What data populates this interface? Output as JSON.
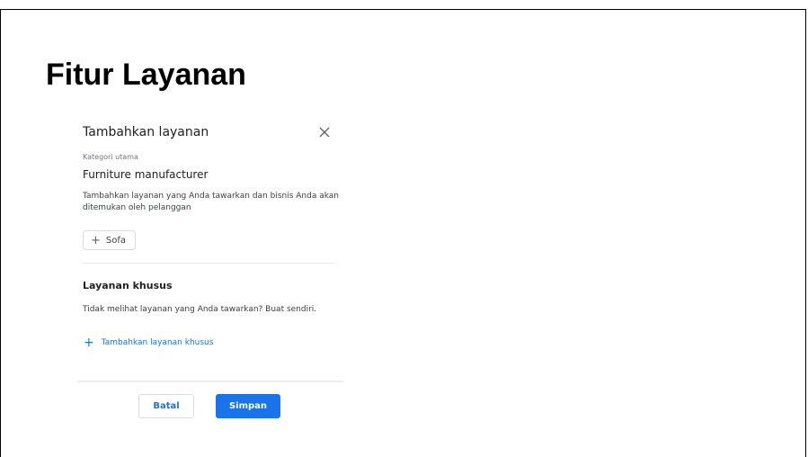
{
  "slide": {
    "title": "Fitur Layanan"
  },
  "dialog": {
    "title": "Tambahkan layanan",
    "close_icon": "close-icon",
    "category_label": "Kategori utama",
    "category_value": "Furniture manufacturer",
    "description": "Tambahkan layanan yang Anda tawarkan dan bisnis Anda akan ditemukan oleh pelanggan",
    "suggestion_chip": {
      "icon": "plus-icon",
      "label": "Sofa"
    },
    "custom_section": {
      "title": "Layanan khusus",
      "description": "Tidak melihat layanan yang Anda tawarkan? Buat sendiri.",
      "add_link": "Tambahkan layanan khusus"
    },
    "buttons": {
      "cancel": "Batal",
      "save": "Simpan"
    }
  },
  "colors": {
    "accent": "#1a73e8",
    "text": "#202124",
    "muted": "#70757a",
    "divider": "#e8eaed"
  }
}
